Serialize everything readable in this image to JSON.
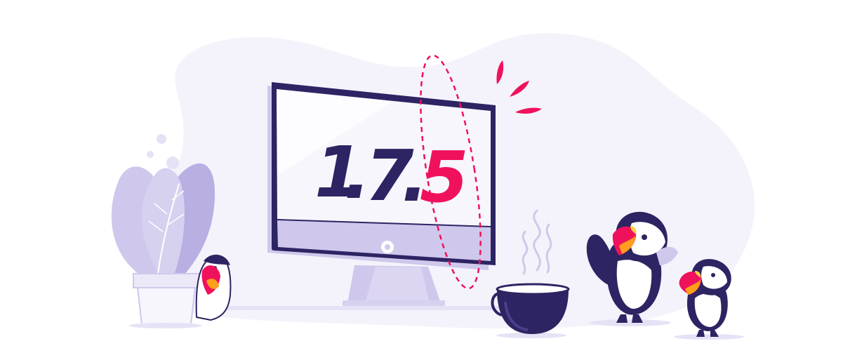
{
  "illustration": {
    "version": {
      "major": "1",
      "sep1": ".",
      "minor": "7",
      "sep2": ".",
      "patch": "5"
    },
    "colors": {
      "navy": "#2d2463",
      "pink": "#f0115c",
      "lavender": "#cfc8ec",
      "lavender_light": "#e6e2f6",
      "blob": "#f4f3fb",
      "screen": "#f7f6fc",
      "orange": "#ff9f1c",
      "yellow": "#ffd23f"
    },
    "icons": [
      "desktop-monitor-icon",
      "potted-plant-icon",
      "coffee-cup-icon",
      "puffin-icon",
      "puffin-icon",
      "puffin-icon"
    ]
  }
}
